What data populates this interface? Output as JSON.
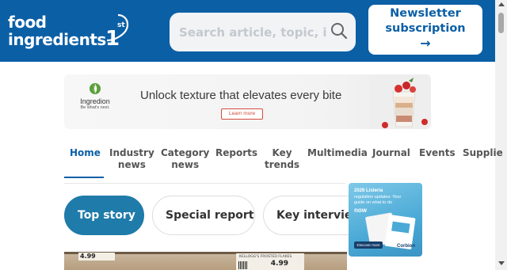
{
  "header": {
    "logo": {
      "line1": "food",
      "line2": "ingredients",
      "superscript": "1",
      "ordinal": "st"
    },
    "search": {
      "placeholder": "Search article, topic, it",
      "icon": "search-icon"
    },
    "newsletter": {
      "line1": "Newsletter",
      "line2": "subscription",
      "arrow": "→"
    },
    "colors": {
      "brand_blue": "#0b5fa5",
      "pill_blue": "#1f7ba9"
    }
  },
  "banner": {
    "brand": "Ingredion",
    "brand_tagline": "Be what's next.",
    "headline": "Unlock texture that elevates every bite",
    "cta": "Learn more"
  },
  "nav": {
    "items": [
      {
        "line1": "Home",
        "line2": ""
      },
      {
        "line1": "Industry",
        "line2": "news"
      },
      {
        "line1": "Category",
        "line2": "news"
      },
      {
        "line1": "Reports",
        "line2": ""
      },
      {
        "line1": "Key",
        "line2": "trends"
      },
      {
        "line1": "Multimedia",
        "line2": ""
      },
      {
        "line1": "Journal",
        "line2": ""
      },
      {
        "line1": "Events",
        "line2": ""
      },
      {
        "line1": "Supplie",
        "line2": ""
      }
    ],
    "active": "Home"
  },
  "pills": {
    "top_story": "Top story",
    "special_report": "Special report",
    "key_interviews": "Key interview"
  },
  "side_ad": {
    "line1": "2026 Listeria",
    "line2": "regulation updates: Your guide on what to do",
    "line3": "now",
    "cta": "Discover more",
    "brand": "Corbion"
  },
  "story_image": {
    "price_left": "4.99",
    "tag_text": "KELLOGG'S FROSTED FLAKES",
    "price_right": "4.99"
  }
}
